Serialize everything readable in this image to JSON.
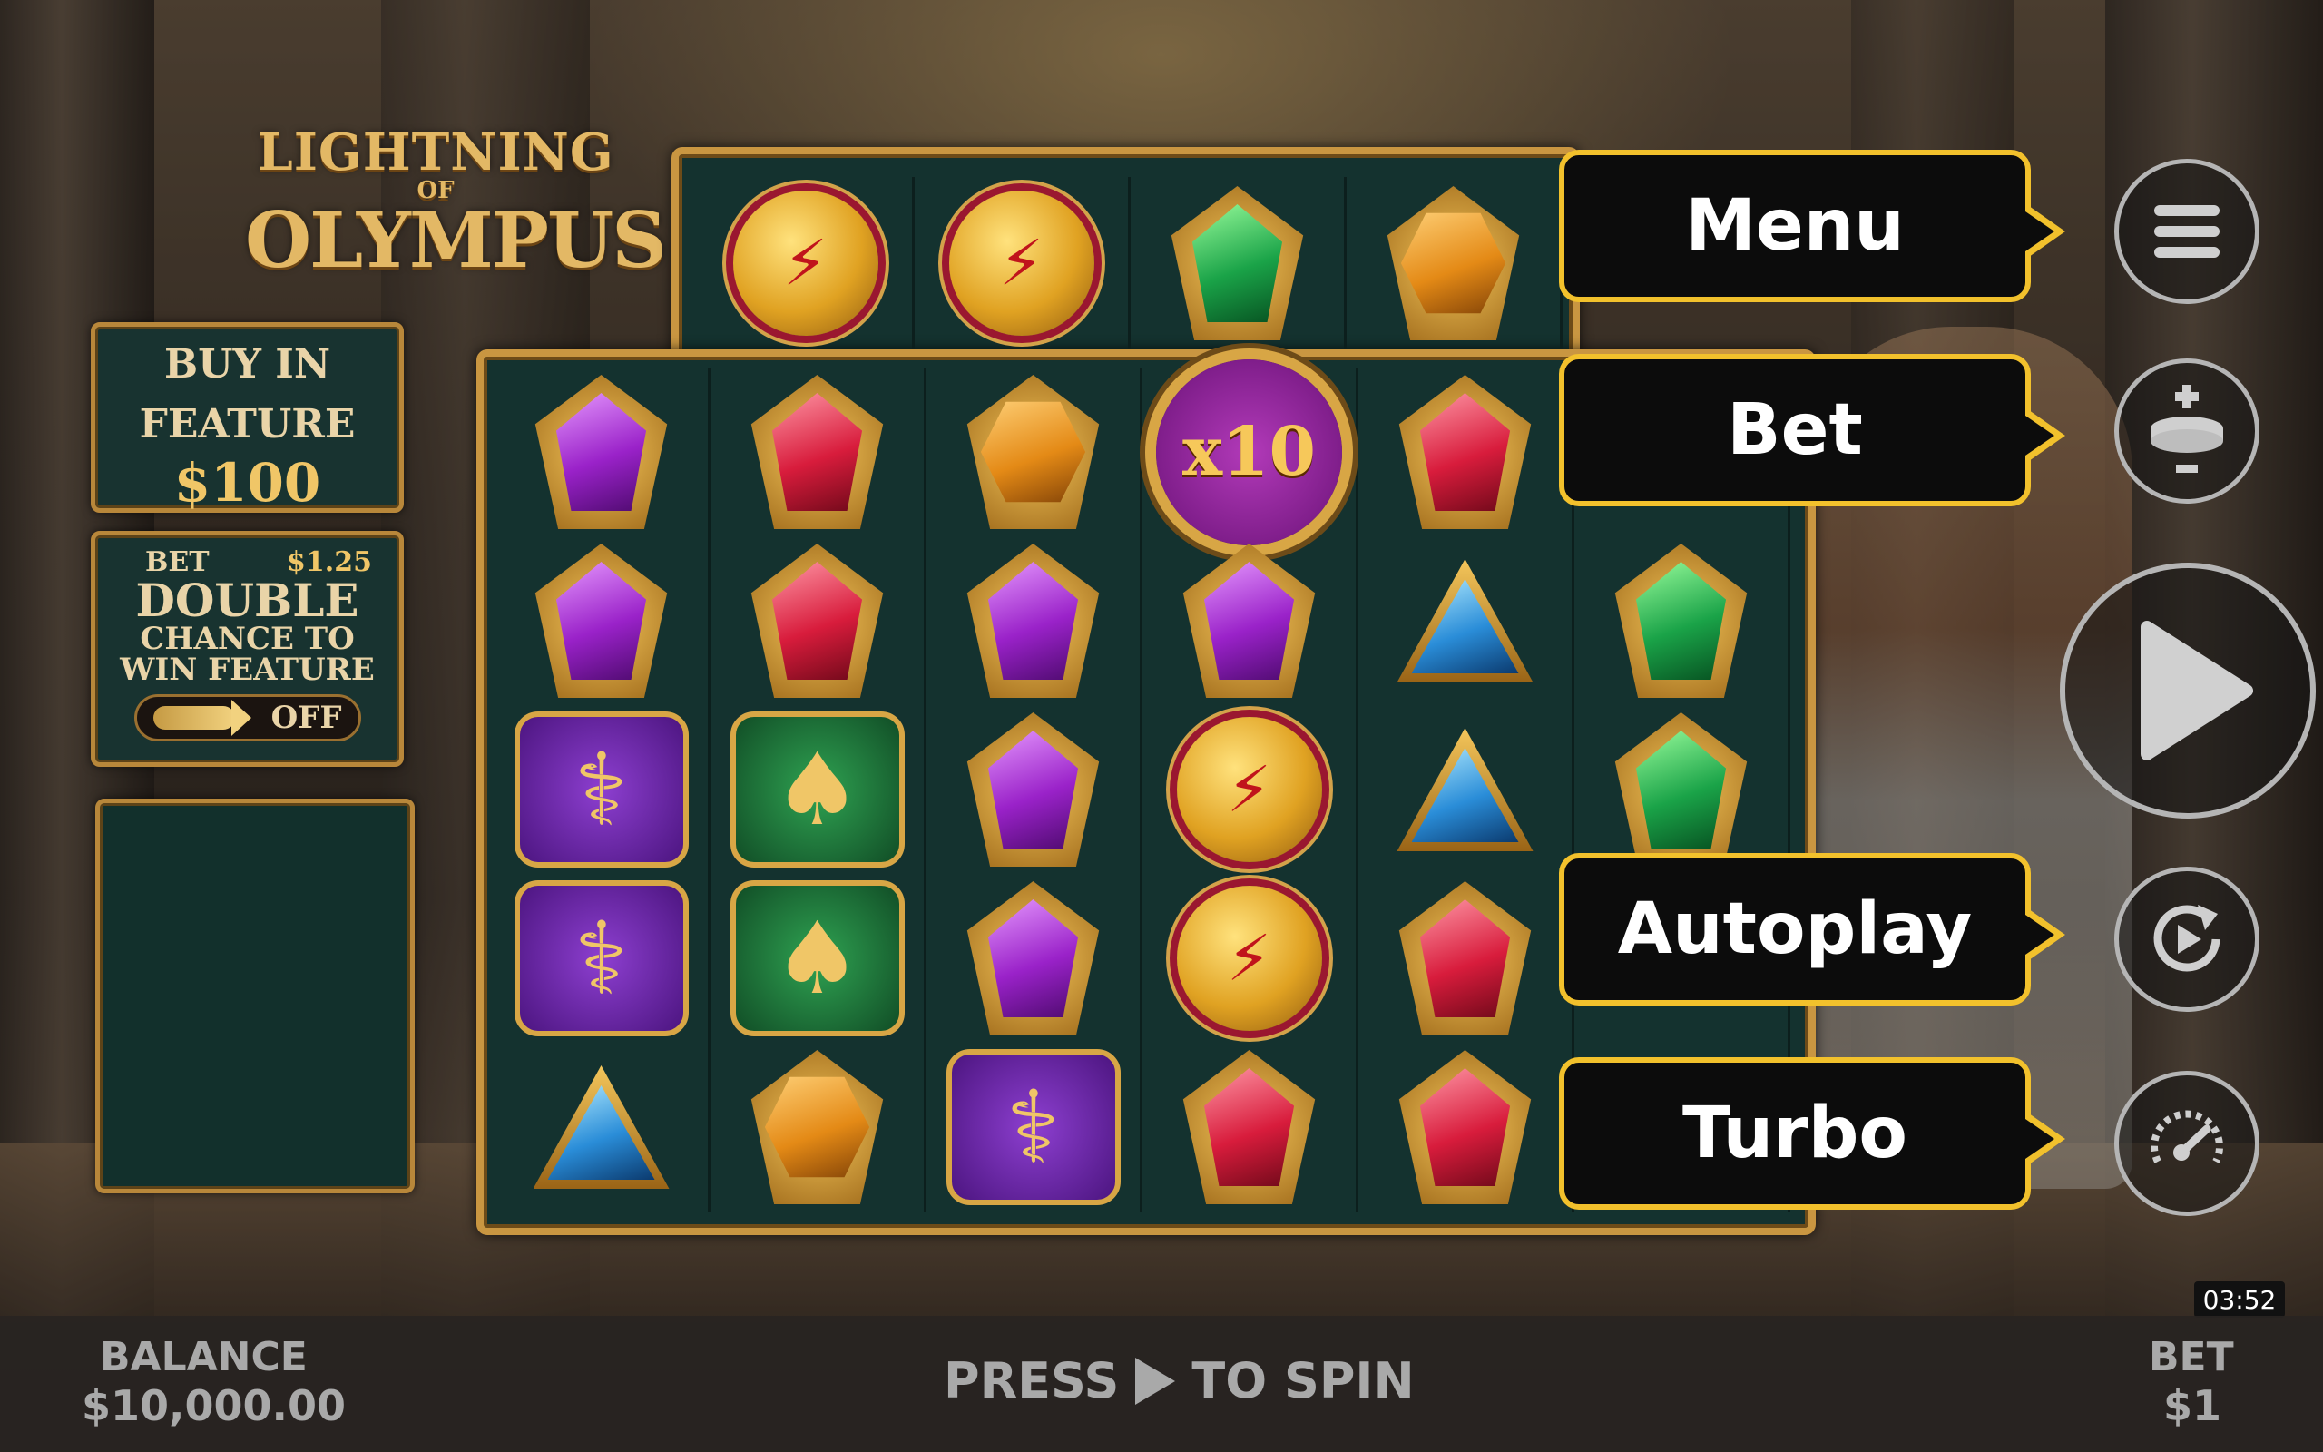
{
  "game": {
    "logo_line1": "LIGHTNING",
    "logo_line2": "OF",
    "logo_line3": "OLYMPUS"
  },
  "buy_feature": {
    "line1": "BUY IN",
    "line2": "FEATURE",
    "price": "$100"
  },
  "double_chance": {
    "bet_label": "BET",
    "bet_value": "$1.25",
    "line1": "DOUBLE",
    "line2": "CHANCE TO",
    "line3": "WIN FEATURE",
    "toggle_state": "OFF"
  },
  "reels": {
    "top_row": [
      "coin",
      "coin",
      "green",
      "orange"
    ],
    "rows": [
      [
        "purple",
        "red",
        "orange",
        "multiplier",
        "red",
        ""
      ],
      [
        "purple",
        "red",
        "purple",
        "purple",
        "blue",
        "green"
      ],
      [
        "harp",
        "cup",
        "purple",
        "coin",
        "blue",
        "green"
      ],
      [
        "harp",
        "cup",
        "purple",
        "coin",
        "red",
        ""
      ],
      [
        "blue",
        "orange",
        "harp",
        "red",
        "red",
        ""
      ]
    ],
    "multiplier_label": "x10"
  },
  "tooltips": {
    "menu": "Menu",
    "bet": "Bet",
    "autoplay": "Autoplay",
    "turbo": "Turbo"
  },
  "icons": {
    "menu": "hamburger-icon",
    "bet": "coin-stack-plus-minus-icon",
    "spin": "play-icon",
    "autoplay": "autoplay-icon",
    "turbo": "speedometer-icon"
  },
  "status_bar": {
    "balance_label": "BALANCE",
    "balance_value": "$10,000.00",
    "press_text": "PRESS",
    "to_spin_text": "TO SPIN",
    "bet_label": "BET",
    "bet_value": "$1",
    "clock": "03:52"
  },
  "colors": {
    "accent": "#f2c12c",
    "gold": "#c99641",
    "reel_bg": "#14322f"
  }
}
